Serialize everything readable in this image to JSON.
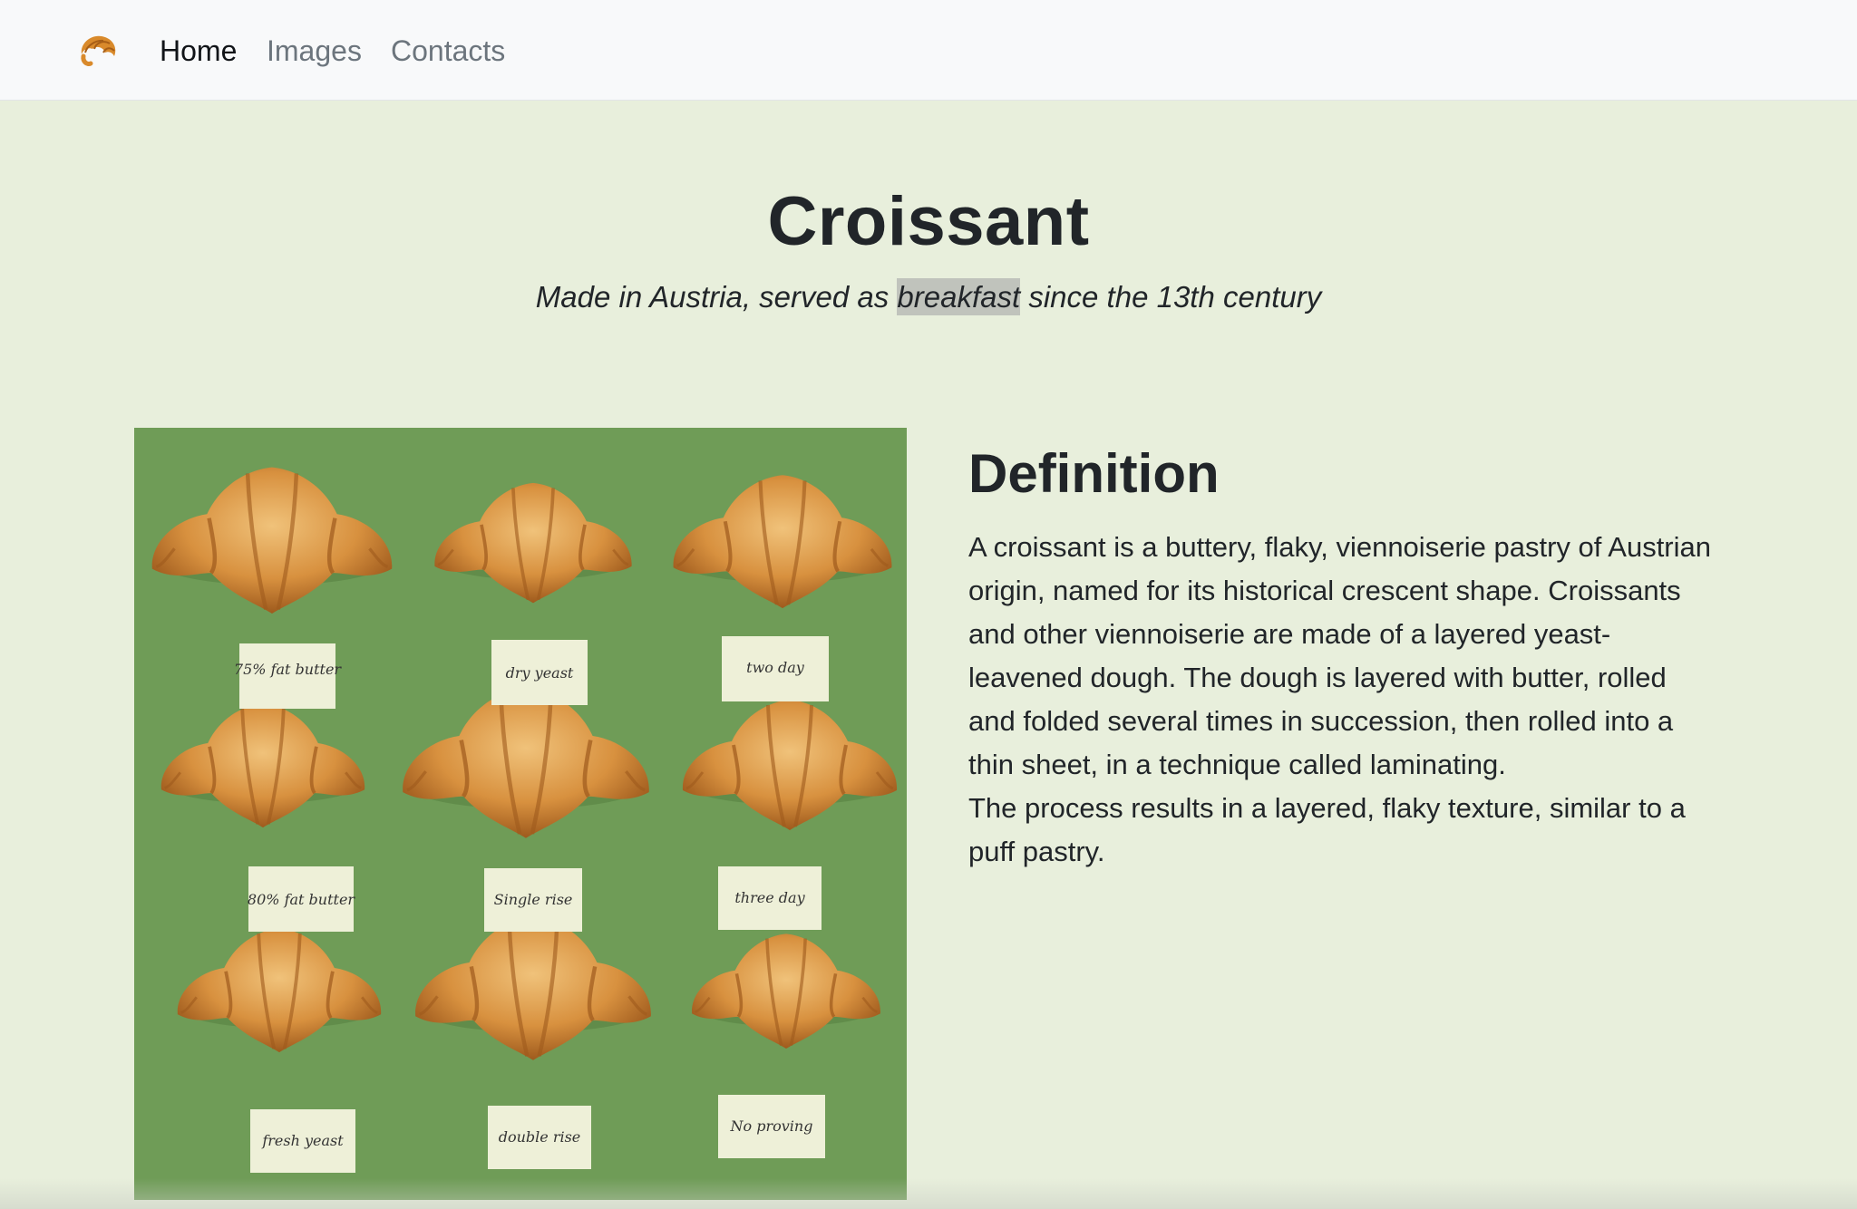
{
  "nav": {
    "brand_icon": "croissant-icon",
    "items": [
      {
        "label": "Home",
        "active": true
      },
      {
        "label": "Images",
        "active": false
      },
      {
        "label": "Contacts",
        "active": false
      }
    ]
  },
  "hero": {
    "title": "Croissant",
    "subtitle_before": "Made in Austria, served as ",
    "subtitle_highlight": "breakfast",
    "subtitle_after": " since the 13th century"
  },
  "photo": {
    "labels": [
      "75% fat butter",
      "dry yeast",
      "two day",
      "80% fat butter",
      "Single rise",
      "three day",
      "fresh yeast",
      "double rise",
      "No proving"
    ]
  },
  "definition": {
    "heading": "Definition",
    "paragraph1": "A croissant is a buttery, flaky, viennoiserie pastry of Austrian origin, named for its historical crescent shape. Croissants and other viennoiserie are made of a layered yeast-leavened dough. The dough is layered with butter, rolled and folded several times in succession, then rolled into a thin sheet, in a technique called laminating.",
    "paragraph2": "The process results in a layered, flaky texture, similar to a puff pastry."
  },
  "colors": {
    "page_background": "#e8efdc",
    "navbar_background": "#f8f9fa",
    "photo_background": "#6f9c57",
    "highlight": "#c0c3bc"
  }
}
